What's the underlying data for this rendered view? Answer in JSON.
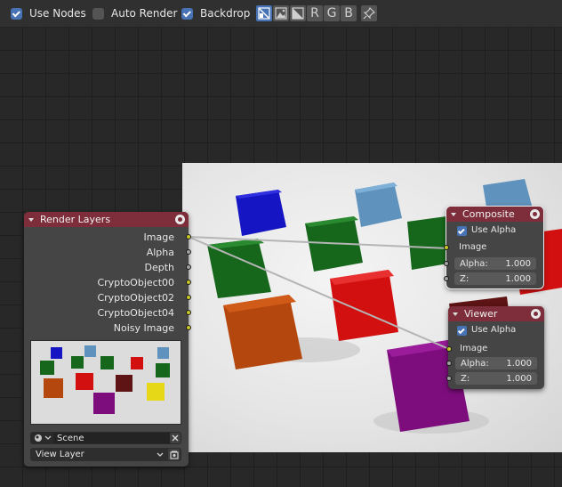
{
  "header": {
    "use_nodes": {
      "label": "Use Nodes",
      "checked": true
    },
    "auto_render": {
      "label": "Auto Render",
      "checked": false
    },
    "backdrop": {
      "label": "Backdrop",
      "checked": true
    },
    "channel_buttons": [
      {
        "name": "color-alpha",
        "label": "",
        "active": true
      },
      {
        "name": "color",
        "label": "",
        "active": false
      },
      {
        "name": "alpha",
        "label": "",
        "active": false
      },
      {
        "name": "r",
        "label": "R",
        "active": false
      },
      {
        "name": "g",
        "label": "G",
        "active": false
      },
      {
        "name": "b",
        "label": "B",
        "active": false
      },
      {
        "name": "pin",
        "label": "",
        "active": false
      }
    ]
  },
  "render_layers": {
    "title": "Render Layers",
    "outputs": [
      "Image",
      "Alpha",
      "Depth",
      "CryptoObject00",
      "CryptoObject02",
      "CryptoObject04",
      "Noisy Image"
    ],
    "scene": "Scene",
    "view_layer": "View Layer"
  },
  "composite": {
    "title": "Composite",
    "use_alpha": "Use Alpha",
    "image_label": "Image",
    "alpha_label": "Alpha:",
    "alpha_value": "1.000",
    "z_label": "Z:",
    "z_value": "1.000"
  },
  "viewer": {
    "title": "Viewer",
    "use_alpha": "Use Alpha",
    "image_label": "Image",
    "alpha_label": "Alpha:",
    "alpha_value": "1.000",
    "z_label": "Z:",
    "z_value": "1.000"
  },
  "colors": {
    "header_bg": "#303030",
    "node_header": "#7d2e3a",
    "checkbox_on": "#4772b3",
    "socket_color": "#c7c729",
    "socket_grey": "#a1a1a1"
  }
}
